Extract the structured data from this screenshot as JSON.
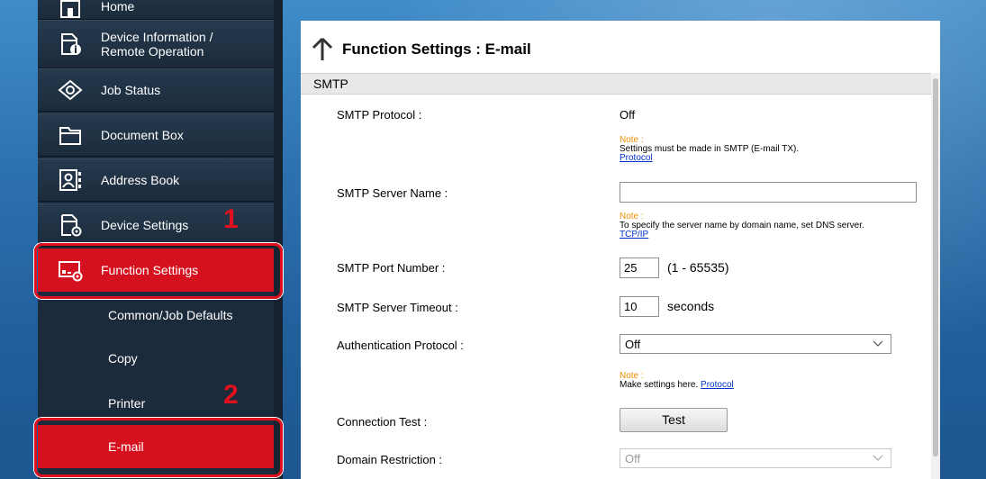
{
  "sidebar": {
    "items": [
      {
        "label": "Home",
        "icon": "home-icon"
      },
      {
        "label_line1": "Device Information /",
        "label_line2": "Remote Operation",
        "icon": "device-info-icon"
      },
      {
        "label": "Job Status",
        "icon": "eye-icon"
      },
      {
        "label": "Document Box",
        "icon": "folder-icon"
      },
      {
        "label": "Address Book",
        "icon": "address-book-icon"
      },
      {
        "label": "Device Settings",
        "icon": "device-settings-icon"
      },
      {
        "label": "Function Settings",
        "icon": "function-settings-icon"
      }
    ],
    "subitems": [
      {
        "label": "Common/Job Defaults"
      },
      {
        "label": "Copy"
      },
      {
        "label": "Printer"
      },
      {
        "label": "E-mail"
      }
    ],
    "markers": {
      "one": "1",
      "two": "2"
    }
  },
  "page": {
    "title": "Function Settings : E-mail",
    "section": "SMTP"
  },
  "form": {
    "smtp_protocol": {
      "label": "SMTP Protocol :",
      "value": "Off"
    },
    "note1": {
      "note": "Note :",
      "text": "Settings must be made in SMTP (E-mail TX).",
      "link": "Protocol"
    },
    "server_name": {
      "label": "SMTP Server Name :",
      "value": ""
    },
    "note2": {
      "note": "Note :",
      "text": "To specify the server name by domain name, set DNS server.",
      "link": "TCP/IP"
    },
    "port": {
      "label": "SMTP Port Number :",
      "value": "25",
      "range": "(1 - 65535)"
    },
    "timeout": {
      "label": "SMTP Server Timeout :",
      "value": "10",
      "unit": "seconds"
    },
    "auth": {
      "label": "Authentication Protocol :",
      "value": "Off"
    },
    "note3": {
      "note": "Note :",
      "text": "Make settings here.",
      "link": "Protocol"
    },
    "conn_test": {
      "label": "Connection Test :",
      "button": "Test"
    },
    "domain": {
      "label": "Domain Restriction :",
      "value": "Off"
    }
  },
  "colors": {
    "accent": "#d5111f",
    "sidebar": "#1b2b3b",
    "note": "#f08c00",
    "link": "#0033cc"
  }
}
